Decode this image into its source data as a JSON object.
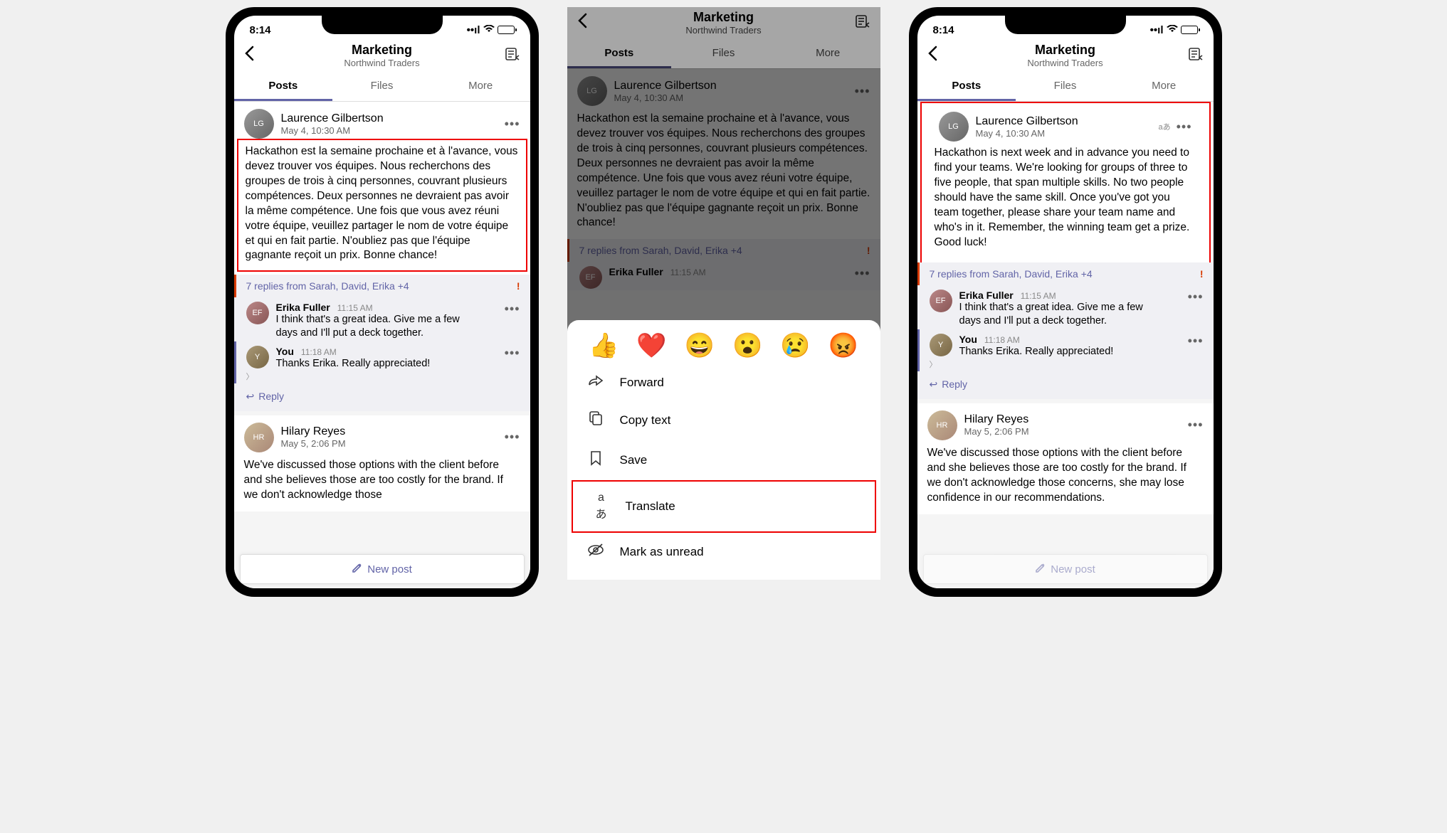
{
  "status": {
    "time": "8:14"
  },
  "header": {
    "title": "Marketing",
    "subtitle": "Northwind Traders"
  },
  "tabs": {
    "posts": "Posts",
    "files": "Files",
    "more": "More"
  },
  "post1": {
    "author": "Laurence Gilbertson",
    "time": "May 4, 10:30 AM",
    "body_fr": "Hackathon est la semaine prochaine et à l'avance, vous devez trouver vos équipes. Nous recherchons des groupes de trois à cinq personnes, couvrant plusieurs compétences. Deux personnes ne devraient pas avoir la même compétence. Une fois que vous avez réuni votre équipe, veuillez partager le nom de votre équipe et qui en fait partie. N'oubliez pas que l'équipe gagnante reçoit un prix. Bonne chance!",
    "body_en": "Hackathon is next week and in advance you need to find your teams. We're looking for groups of three to five people, that span multiple skills. No two people should have the same skill. Once you've got you team together, please share your team name and who's in it. Remember, the winning team get a prize. Good luck!",
    "replies_summary": "7 replies from Sarah, David, Erika +4"
  },
  "reply1": {
    "author": "Erika Fuller",
    "time": "11:15 AM",
    "text": "I think that's a great idea. Give me a few days and I'll put a deck together."
  },
  "reply2": {
    "author": "You",
    "time": "11:18 AM",
    "text": "Thanks Erika. Really appreciated!"
  },
  "reply_label": "Reply",
  "post2": {
    "author": "Hilary Reyes",
    "time": "May 5, 2:06 PM",
    "body_short": "We've discussed those options with the client before and she believes those are too costly for the brand. If we don't acknowledge those",
    "body_long": "We've discussed those options with the client before and she believes those are too costly for the brand. If we don't acknowledge those concerns, she may lose confidence in our recommendations."
  },
  "new_post": "New post",
  "sheet": {
    "forward": "Forward",
    "copy": "Copy text",
    "save": "Save",
    "translate": "Translate",
    "unread": "Mark as unread"
  },
  "emoji": {
    "like": "👍",
    "heart": "❤️",
    "laugh": "😄",
    "surprised": "😮",
    "sad": "😢",
    "angry": "😡"
  },
  "translate_badge": "aあ"
}
